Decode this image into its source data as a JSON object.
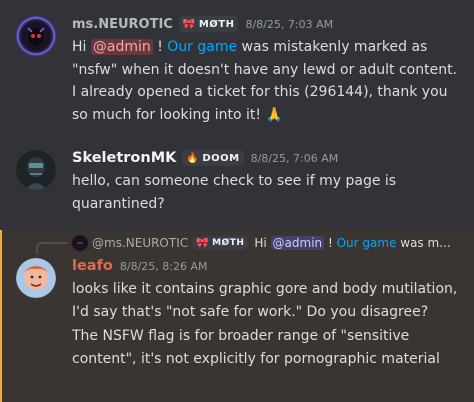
{
  "messages": [
    {
      "username": "ms.NEUROTIC",
      "username_color": "#b5bac1",
      "tag": "MØTH",
      "tag_icon": "bow-icon",
      "timestamp": "8/8/25, 7:03 AM",
      "parts": {
        "pre": "Hi ",
        "mention": "@admin",
        "mid": " ! ",
        "link": "Our game",
        "post": " was mistakenly marked as \"nsfw\" when it doesn't have any lewd or adult content. I already opened a ticket for this (296144), thank you so much for looking into it! ",
        "emoji": "🙏"
      }
    },
    {
      "username": "SkeletronMK",
      "username_color": "#f2f3f5",
      "tag": "DOOM",
      "tag_icon": "fire-icon",
      "timestamp": "8/8/25, 7:06 AM",
      "text": "hello, can someone check to see if my page is quarantined?"
    },
    {
      "reply": {
        "username": "@ms.NEUROTIC",
        "tag": "MØTH",
        "pre": "Hi ",
        "mention": "@admin",
        "mid": " ! ",
        "link": "Our game",
        "post": " was m",
        "ellipsis": "..."
      },
      "username": "leafo",
      "username_color": "#e06c4c",
      "timestamp": "8/8/25, 8:26 AM",
      "lines": [
        "looks like it contains graphic gore and body mutilation, I'd say that's \"not safe for work.\" Do you disagree?",
        "The NSFW flag is for broader range of \"sensitive content\", it's not explicitly for pornographic material"
      ]
    }
  ],
  "colors": {
    "background": "#313338",
    "highlight_bg": "#3a3530",
    "highlight_bar": "#f0b232",
    "link": "#00a8fc"
  }
}
